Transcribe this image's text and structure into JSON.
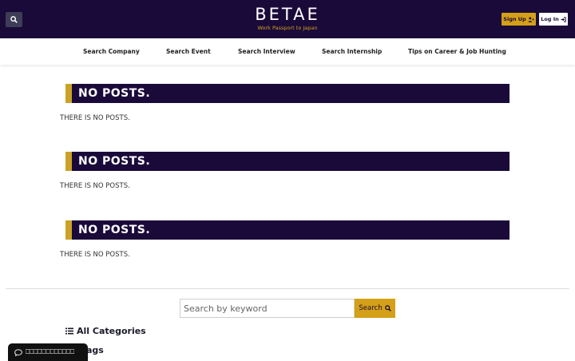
{
  "header": {
    "logo_text": "BETAE",
    "tagline": "Work Passport to Japan",
    "signup_label": "Sign Up",
    "login_label": "Log In",
    "bg_color": "#1a0a3a",
    "accent_color": "#d4a017"
  },
  "nav": {
    "items": [
      {
        "label": "Search Company"
      },
      {
        "label": "Search Event"
      },
      {
        "label": "Search Interview"
      },
      {
        "label": "Search Internship"
      },
      {
        "label": "Tips on Career & Job Hunting"
      }
    ]
  },
  "sections": [
    {
      "title": "NO POSTS.",
      "text": "THERE IS NO POSTS."
    },
    {
      "title": "NO POSTS.",
      "text": "THERE IS NO POSTS."
    },
    {
      "title": "NO POSTS.",
      "text": "THERE IS NO POSTS."
    }
  ],
  "search": {
    "placeholder": "Search by keyword",
    "button_label": "Search"
  },
  "sidebar": {
    "categories_label": "All Categories",
    "tags_label": "All Tags"
  },
  "chat": {
    "label": "⎕⎕⎕⎕⎕⎕⎕⎕⎕⎕⎕⎕"
  },
  "icons": {
    "search": "search-icon",
    "signup": "user-plus-icon",
    "login": "sign-in-icon",
    "list": "list-icon",
    "chat": "chat-bubble-icon"
  }
}
